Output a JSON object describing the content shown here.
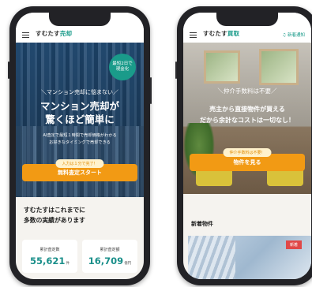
{
  "left": {
    "logo_prefix": "すむたす",
    "logo_accent": "売却",
    "badge_line1": "最短2日で",
    "badge_line2": "現金化",
    "hero_tag": "＼マンション売却に悩まない／",
    "hero_title_line1": "マンション売却が",
    "hero_title_line2": "驚くほど簡単に",
    "hero_desc_line1": "AI査定で最短１時間で売却価格がわかる",
    "hero_desc_line2": "お好きなタイミングで売却できる",
    "pill": "入力は１分で完了！",
    "cta": "無料査定スタート",
    "section_line1": "すむたすはこれまでに",
    "section_line2": "多数の実績があります",
    "stats": [
      {
        "label": "累計査定数",
        "value": "55,621",
        "unit": "件"
      },
      {
        "label": "累計査定額",
        "value": "16,709",
        "unit": "億円"
      }
    ]
  },
  "right": {
    "logo_prefix": "すむたす",
    "logo_accent": "買取",
    "header_link": "新着通知",
    "hero_tag": "＼仲介手数料は不要／",
    "hero_title_line1": "売主から直接物件が買える",
    "hero_title_line2": "だから余計なコストは一切なし！",
    "pill": "仲介手数料は不要！",
    "cta": "物件を見る",
    "new_title": "新着物件",
    "card_badge": "新着"
  }
}
